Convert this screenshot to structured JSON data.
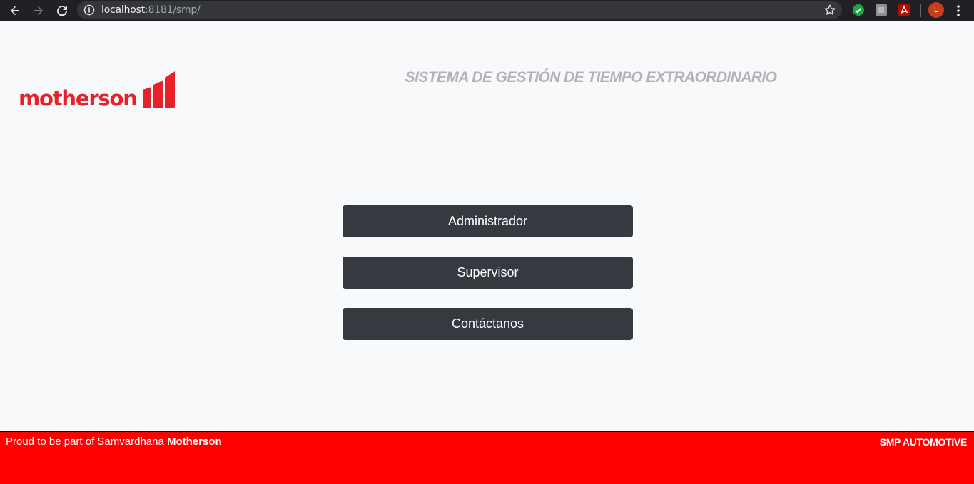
{
  "browser": {
    "url_host": "localhost",
    "url_rest": ":8181/smp/",
    "avatar_letter": "L",
    "icons": [
      "back-arrow-icon",
      "forward-arrow-icon",
      "reload-icon",
      "info-icon",
      "star-icon",
      "check-extension-icon",
      "grey-extension-icon",
      "pdf-extension-icon",
      "kebab-menu-icon"
    ]
  },
  "header": {
    "logo_text": "motherson",
    "system_title": "SISTEMA DE GESTIÓN DE TIEMPO EXTRAORDINARIO"
  },
  "menu": {
    "admin_label": "Administrador",
    "supervisor_label": "Supervisor",
    "contact_label": "Contáctanos"
  },
  "footer": {
    "left_text": "Proud to be part of Samvardhana ",
    "left_bold": "Motherson",
    "right_text": "SMP AUTOMOTIVE"
  },
  "colors": {
    "brand_red": "#e62129",
    "footer_red": "#ff0000",
    "button_dark": "#343a40",
    "title_gray": "#b2b3b6",
    "page_bg": "#f8f9fb"
  }
}
